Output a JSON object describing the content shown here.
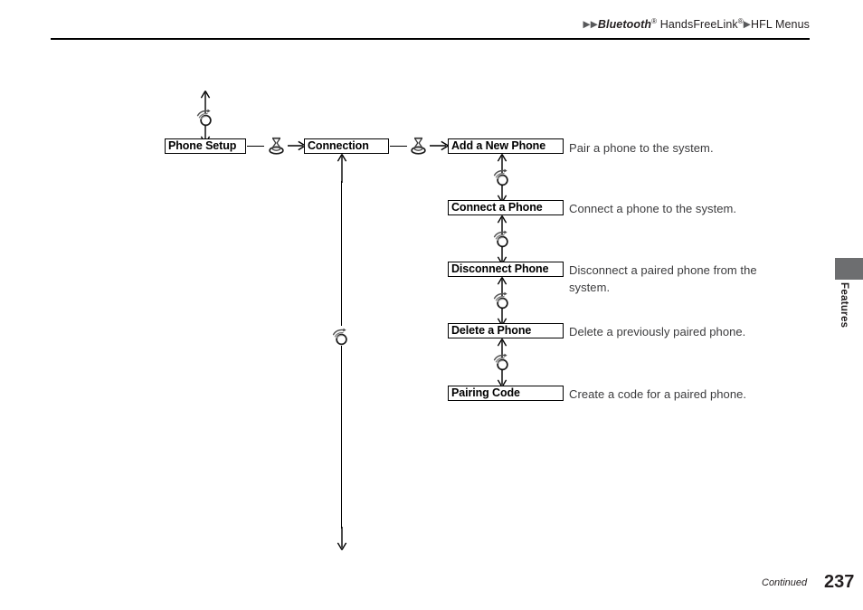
{
  "header": {
    "breadcrumb_arrow": "▶",
    "crumb1": "Bluetooth",
    "crumb1_sup": "®",
    "crumb2": "HandsFreeLink",
    "crumb2_sup": "®",
    "crumb3": "HFL Menus"
  },
  "side_tab": {
    "label": "Features"
  },
  "footer": {
    "continued": "Continued",
    "page_number": "237"
  },
  "diagram": {
    "root_box": "Phone Setup",
    "second_box": "Connection",
    "icons": {
      "rotate_knob": "rotate-knob-icon",
      "press_knob": "press-knob-icon"
    },
    "menu_items": [
      {
        "label": "Add a New Phone",
        "description": "Pair a phone to the system."
      },
      {
        "label": "Connect a Phone",
        "description": "Connect a phone to the system."
      },
      {
        "label": "Disconnect Phone",
        "description": "Disconnect a paired phone from the\nsystem."
      },
      {
        "label": "Delete a Phone",
        "description": "Delete a previously paired phone."
      },
      {
        "label": "Pairing Code",
        "description": "Create a code for a paired phone."
      }
    ]
  },
  "colors": {
    "ink": "#231f20",
    "rule": "#000000",
    "desc_text": "#3b3b3d",
    "tab_gray": "#6d6e70"
  }
}
